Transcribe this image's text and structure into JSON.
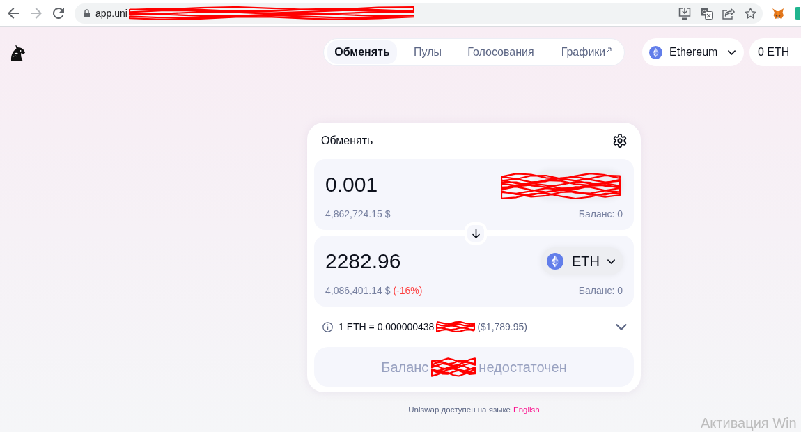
{
  "browser": {
    "forward": {
      "disabled": true
    },
    "address_segments": [
      {
        "kind": "text",
        "text": "app.uni"
      },
      {
        "kind": "redaction"
      }
    ]
  },
  "nav": {
    "tabs": [
      {
        "label": "Обменять",
        "selected": true,
        "external": false
      },
      {
        "label": "Пулы",
        "selected": false,
        "external": false
      },
      {
        "label": "Голосования",
        "selected": false,
        "external": false
      },
      {
        "label": "Графики",
        "selected": false,
        "external": true
      }
    ],
    "network": {
      "label": "Ethereum"
    },
    "wallet": {
      "balance": "0 ETH"
    }
  },
  "swap": {
    "title": "Обменять",
    "input": {
      "amount": "0.001",
      "usd_value": "4,862,724.15 $",
      "balance": "Баланс: 0",
      "token": {
        "kind": "redaction"
      }
    },
    "output": {
      "amount": "2282.96",
      "usd_value": "4,086,401.14 $",
      "price_impact": "(-16%)",
      "balance": "Баланс: 0",
      "token": {
        "kind": "eth",
        "symbol": "ETH"
      }
    },
    "rate_segments": [
      {
        "kind": "text",
        "text": "1 ETH = 0.000000438",
        "muted": false
      },
      {
        "kind": "redaction"
      },
      {
        "kind": "text",
        "text": "($1,789.95)",
        "muted": true
      }
    ],
    "button": {
      "disabled": true,
      "segments": [
        {
          "kind": "text",
          "text": "Баланс"
        },
        {
          "kind": "redaction"
        },
        {
          "kind": "text",
          "text": "недостаточен"
        }
      ]
    }
  },
  "footer": {
    "text": "Uniswap доступен на языке",
    "link": "English"
  },
  "os_notice": "Активация Win"
}
